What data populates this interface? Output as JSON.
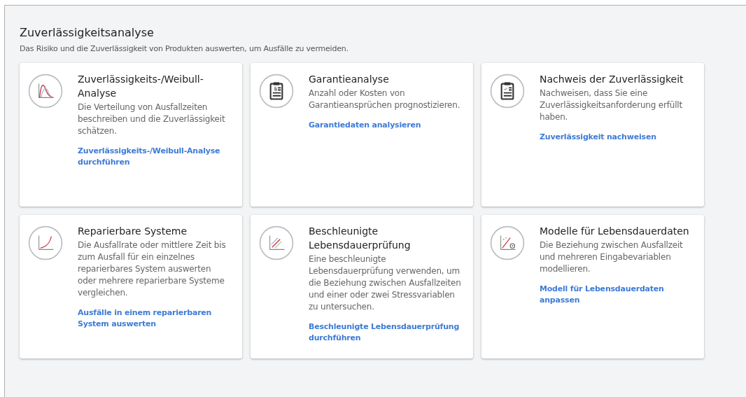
{
  "header": {
    "title": "Zuverlässigkeitsanalyse",
    "subtitle": "Das Risiko und die Zuverlässigkeit von Produkten auswerten, um Ausfälle zu vermeiden."
  },
  "cards": [
    {
      "kind": "weibull",
      "title": "Zuverlässigkeits-/Weibull-Analyse",
      "description": "Die Verteilung von Ausfallzeiten beschreiben und die Zuverlässigkeit schätzen.",
      "link": "Zuverlässigkeits-/Weibull-Analyse durchführen"
    },
    {
      "kind": "warranty",
      "title": "Garantieanalyse",
      "description": "Anzahl oder Kosten von Garantieansprüchen prognostizieren.",
      "link": "Garantiedaten analysieren"
    },
    {
      "kind": "demonstration",
      "title": "Nachweis der Zuverlässigkeit",
      "description": "Nachweisen, dass Sie eine Zuverlässigkeitsanforderung erfüllt haben.",
      "link": "Zuverlässigkeit nachweisen"
    },
    {
      "kind": "repairable",
      "title": "Reparierbare Systeme",
      "description": "Die Ausfallrate oder mittlere Zeit bis zum Ausfall für ein einzelnes reparierbares System auswerten oder mehrere reparierbare Systeme vergleichen.",
      "link": "Ausfälle in einem reparierbaren System auswerten"
    },
    {
      "kind": "accelerated",
      "title": "Beschleunigte Lebensdauerprüfung",
      "description": "Eine beschleunigte Lebensdauerprüfung verwenden, um die Beziehung zwischen Ausfallzeiten und einer oder zwei Stressvariablen zu untersuchen.",
      "link": "Beschleunigte Lebensdauerprüfung durchführen"
    },
    {
      "kind": "regression",
      "title": "Modelle für Lebensdauerdaten",
      "description": "Die Beziehung zwischen Ausfallzeit und mehreren Eingabevariablen modellieren.",
      "link": "Modell für Lebensdauerdaten anpassen"
    }
  ]
}
